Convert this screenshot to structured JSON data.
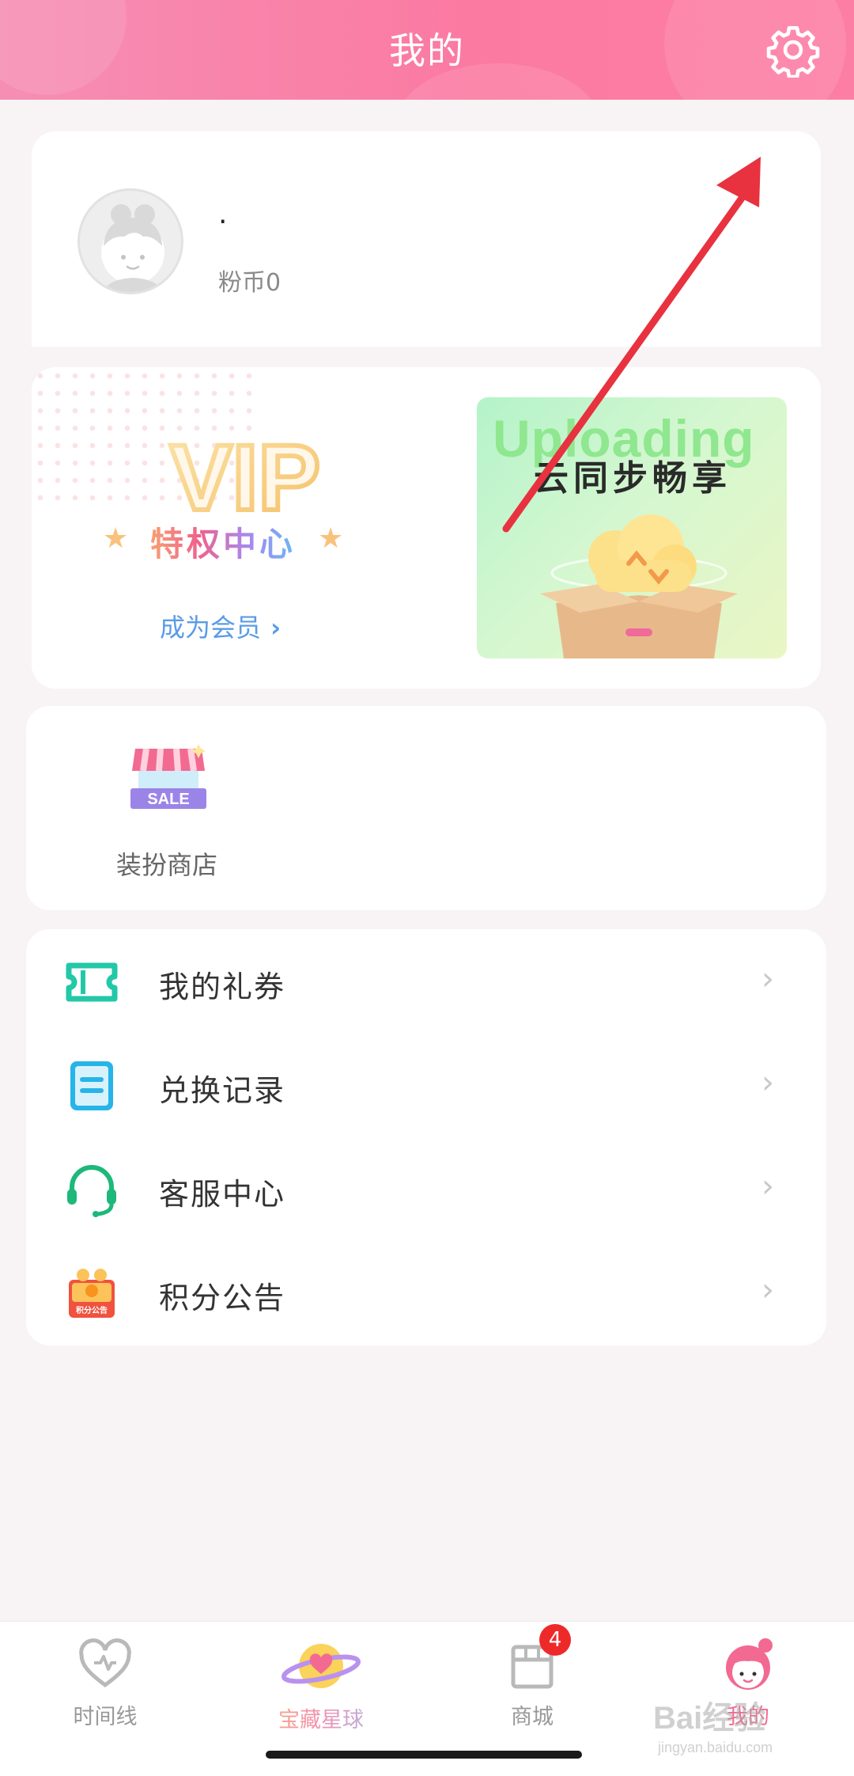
{
  "header": {
    "title": "我的",
    "settings_icon": "gear-icon"
  },
  "profile": {
    "username": ".",
    "coins_label": "粉币0"
  },
  "vip": {
    "logo_text": "VIP",
    "subtitle": "特权中心",
    "cta": "成为会员",
    "banner_title": "云同步畅享",
    "banner_bg_text": "Uploading"
  },
  "shop": {
    "icon_text": "SALE",
    "label": "装扮商店"
  },
  "menu": {
    "items": [
      {
        "label": "我的礼券",
        "icon": "ticket-icon",
        "color": "#22c8a8"
      },
      {
        "label": "兑换记录",
        "icon": "record-icon",
        "color": "#27b4e8"
      },
      {
        "label": "客服中心",
        "icon": "headset-icon",
        "color": "#1db87a"
      },
      {
        "label": "积分公告",
        "icon": "points-gift-icon",
        "color": "#f0523f"
      }
    ],
    "points_icon_text": "积分公告"
  },
  "bottom_nav": {
    "items": [
      {
        "label": "时间线",
        "icon": "heart-timeline-icon"
      },
      {
        "label": "宝藏星球",
        "icon": "planet-icon"
      },
      {
        "label": "商城",
        "icon": "store-icon",
        "badge": "4"
      },
      {
        "label": "我的",
        "icon": "profile-girl-icon",
        "active": true
      }
    ]
  },
  "watermark": {
    "brand": "Bai经验",
    "url": "jingyan.baidu.com"
  },
  "colors": {
    "accent": "#fb7aa2",
    "link": "#5a9ce6",
    "badge": "#ee2929"
  }
}
